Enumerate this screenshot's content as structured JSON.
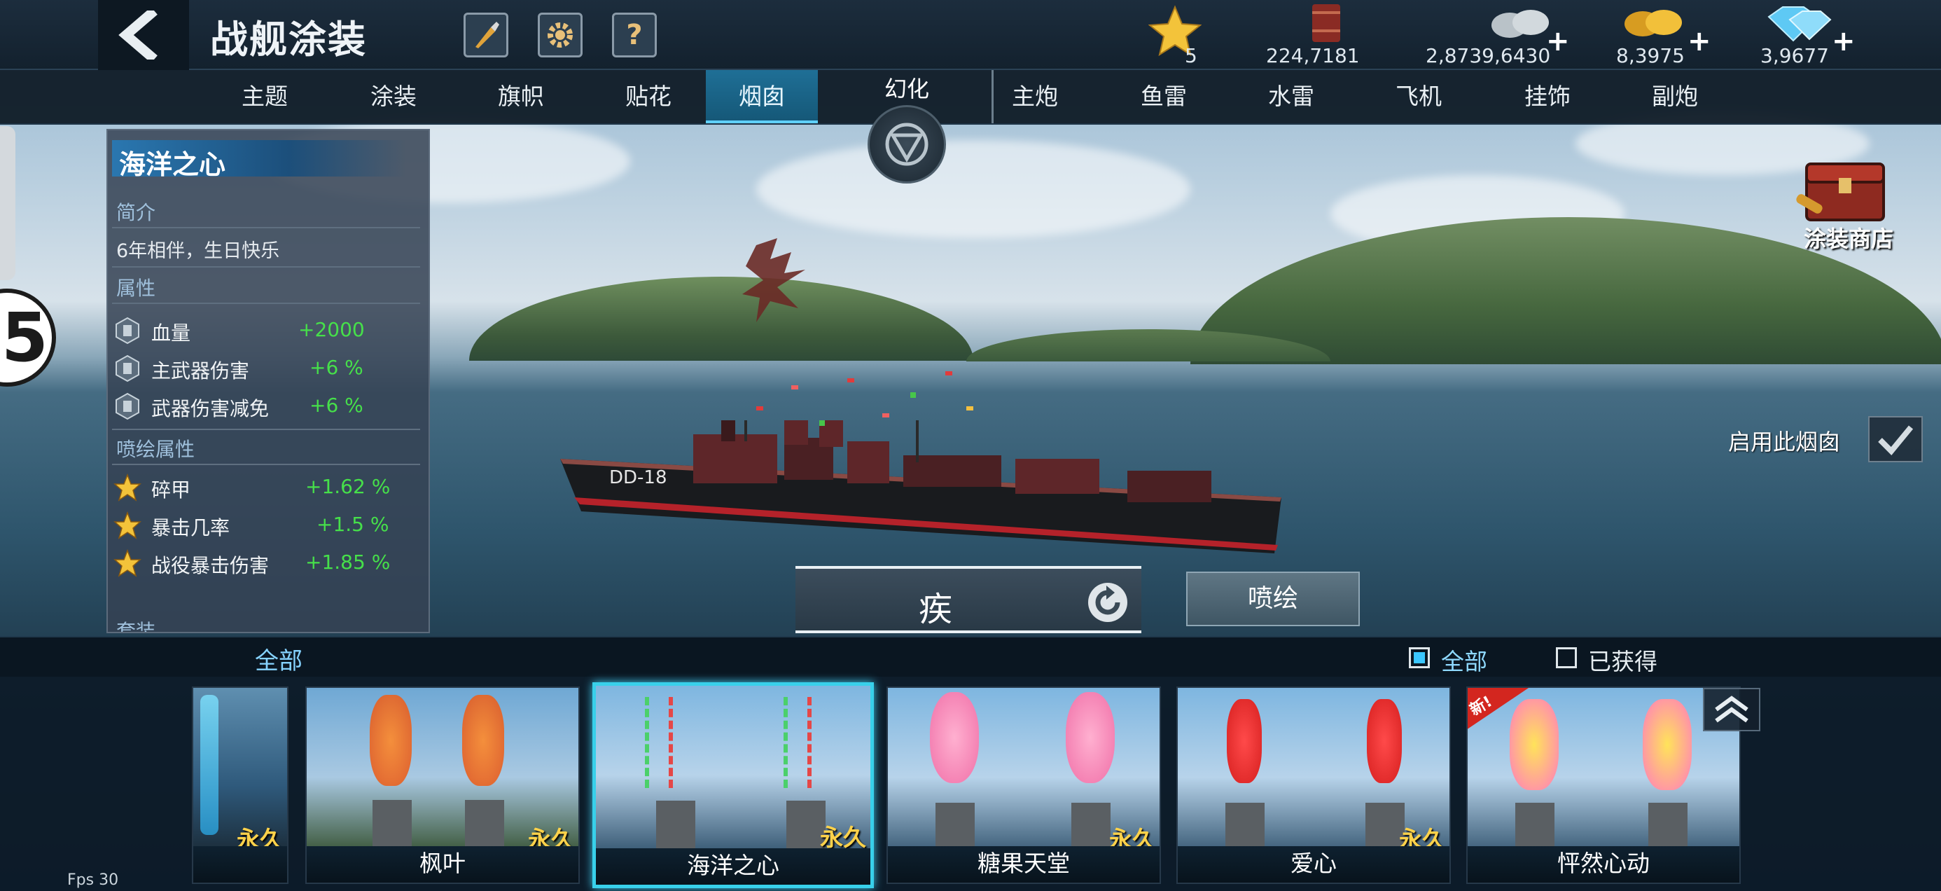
{
  "header": {
    "title": "战舰涂装",
    "icons": [
      "brush-icon",
      "gear-icon",
      "help-icon"
    ],
    "help_label": "?"
  },
  "resources": {
    "star_count": "5",
    "fuel": "224,7181",
    "silver": "2,8739,6430",
    "gold": "8,3975",
    "diamond": "3,9677",
    "plus": "+"
  },
  "tabs": {
    "left": [
      "主题",
      "涂装",
      "旗帜",
      "贴花",
      "烟囱"
    ],
    "right": [
      "主炮",
      "鱼雷",
      "水雷",
      "飞机",
      "挂饰",
      "副炮"
    ],
    "active": "烟囱",
    "center": "幻化"
  },
  "info": {
    "name": "海洋之心",
    "intro_head": "简介",
    "intro_text": "6年相伴，生日快乐",
    "attr_head": "属性",
    "attrs": [
      {
        "name": "血量",
        "value": "+2000"
      },
      {
        "name": "主武器伤害",
        "value": "+6 %"
      },
      {
        "name": "武器伤害减免",
        "value": "+6 %"
      }
    ],
    "paint_head": "喷绘属性",
    "paint_attrs": [
      {
        "name": "碎甲",
        "value": "+1.62 %"
      },
      {
        "name": "暴击几率",
        "value": "+1.5 %"
      },
      {
        "name": "战役暴击伤害",
        "value": "+1.85 %"
      }
    ],
    "more_head": "套装"
  },
  "paint_shop_label": "涂装商店",
  "enable_label": "启用此烟囱",
  "smoke_button": "疾",
  "spray_button": "喷绘",
  "bottom": {
    "category": "全部",
    "filter_all": "全部",
    "filter_owned": "已获得"
  },
  "cards": [
    {
      "name": "",
      "perm": "永久"
    },
    {
      "name": "枫叶",
      "perm": "永久"
    },
    {
      "name": "海洋之心",
      "perm": "永久"
    },
    {
      "name": "糖果天堂",
      "perm": "永久"
    },
    {
      "name": "爱心",
      "perm": "永久"
    },
    {
      "name": "怦然心动",
      "perm": "",
      "badge": "新!"
    }
  ],
  "fps": "Fps 30",
  "side_number": "5",
  "colors": {
    "accent": "#38d0ea",
    "stat_green": "#46e04a",
    "perm_gold": "#ffd24a",
    "active_tab": "#1f6f96"
  }
}
